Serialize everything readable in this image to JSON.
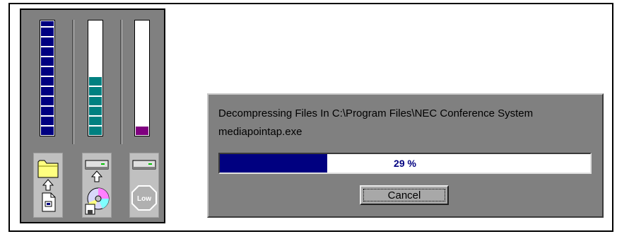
{
  "meters": [
    {
      "name": "source-files",
      "level": 1.0,
      "color": "#000080",
      "icons": [
        "folder-icon",
        "up-arrow-icon",
        "file-icon"
      ]
    },
    {
      "name": "disk-space",
      "level": 0.52,
      "color": "#008080",
      "icons": [
        "drive-icon",
        "up-arrow-icon",
        "cd-disk-icon"
      ]
    },
    {
      "name": "memory",
      "level": 0.09,
      "color": "#800080",
      "icons": [
        "drive-icon",
        "low-stop-icon"
      ]
    }
  ],
  "low_sign_label": "Low",
  "dialog": {
    "line1": "Decompressing Files In C:\\Program Files\\NEC Conference System",
    "line2": "mediapointap.exe",
    "progress_percent": 29,
    "progress_label": "29 %",
    "cancel_label": "Cancel"
  },
  "colors": {
    "panel_gray": "#808080",
    "progress_fill": "#000080",
    "meter_blue": "#000080",
    "meter_teal": "#008080",
    "meter_purple": "#800080",
    "folder_yellow": "#ffff80"
  }
}
